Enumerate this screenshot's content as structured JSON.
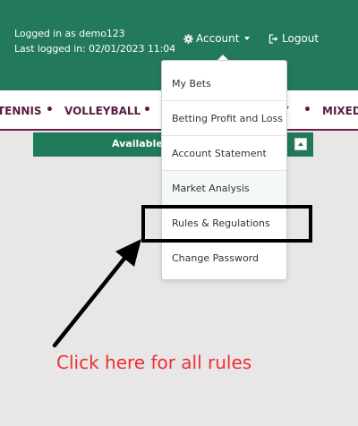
{
  "header": {
    "logged_in": "Logged in as demo123",
    "last_logged": "Last logged in: 02/01/2023 11:04",
    "account_label": "Account",
    "logout_label": "Logout"
  },
  "sports_nav": {
    "items": [
      "TENNIS",
      "VOLLEYBALL",
      "Y",
      "MIXED"
    ]
  },
  "credit_bar": {
    "label": "Available C"
  },
  "account_menu": {
    "items": [
      "My Bets",
      "Betting Profit and Loss",
      "Account Statement",
      "Market Analysis",
      "Rules & Regulations",
      "Change Password"
    ]
  },
  "annotation": {
    "hint": "Click here for all rules",
    "hint_color": "#ee3030"
  },
  "colors": {
    "header_bg": "#23795b",
    "nav_text": "#5b1a45",
    "page_bg": "#e8e6e7"
  }
}
